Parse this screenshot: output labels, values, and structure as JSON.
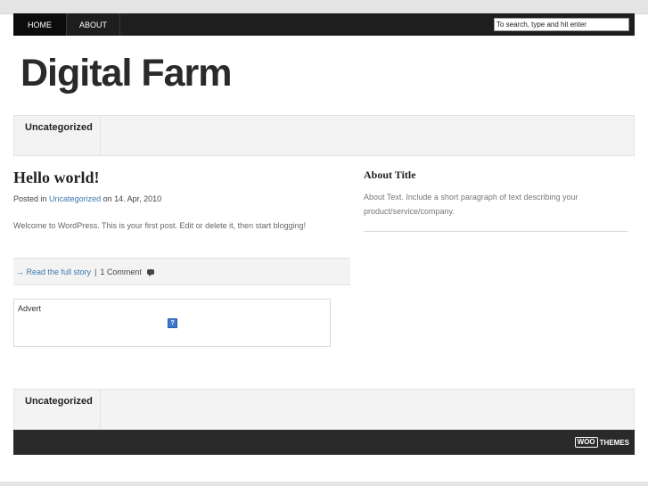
{
  "nav": {
    "items": [
      {
        "label": "HOME",
        "active": true
      },
      {
        "label": "ABOUT",
        "active": false
      }
    ],
    "search_value": "To search, type and hit enter"
  },
  "site": {
    "title": "Digital Farm"
  },
  "categories_top": {
    "tab_label": "Uncategorized"
  },
  "post": {
    "title": "Hello world!",
    "meta_prefix": "Posted in",
    "meta_category": "Uncategorized",
    "meta_on": "on",
    "meta_date": "14. Apr, 2010",
    "body": "Welcome to WordPress. This is your first post. Edit or delete it, then start blogging!",
    "read_more": "→ Read the full story",
    "separator": "|",
    "comments": "1 Comment"
  },
  "advert": {
    "label": "Advert",
    "icon": "?"
  },
  "sidebar": {
    "title": "About Title",
    "text": "About Text. Include a short paragraph of text describing your product/service/company."
  },
  "categories_bottom": {
    "tab_label": "Uncategorized"
  },
  "footer": {
    "logo_box": "WOO",
    "logo_text": "THEMES"
  },
  "colors": {
    "nav_bg": "#1e1e1e",
    "link": "#3a7ab0",
    "footer_bg": "#2a2a2a"
  }
}
